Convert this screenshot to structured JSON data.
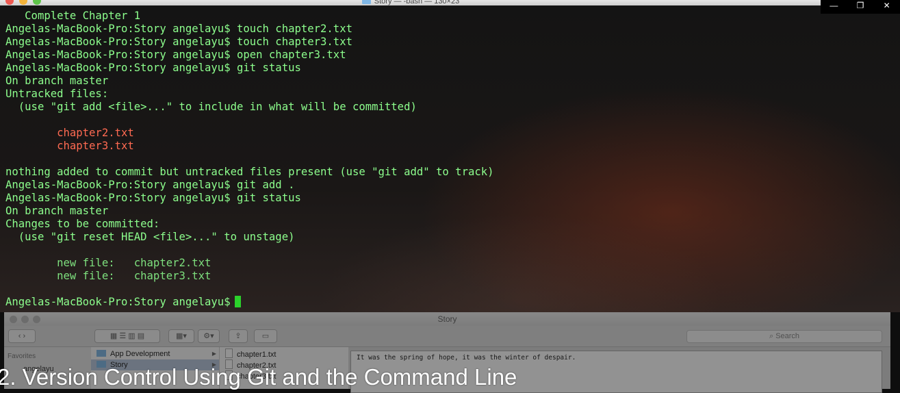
{
  "terminal": {
    "title": "Story — -bash — 130×23",
    "lines": [
      {
        "text": "   Complete Chapter 1",
        "style": "normal"
      },
      {
        "text": "Angelas-MacBook-Pro:Story angelayu$ touch chapter2.txt",
        "style": "normal"
      },
      {
        "text": "Angelas-MacBook-Pro:Story angelayu$ touch chapter3.txt",
        "style": "normal"
      },
      {
        "text": "Angelas-MacBook-Pro:Story angelayu$ open chapter3.txt",
        "style": "normal"
      },
      {
        "text": "Angelas-MacBook-Pro:Story angelayu$ git status",
        "style": "normal"
      },
      {
        "text": "On branch master",
        "style": "normal"
      },
      {
        "text": "Untracked files:",
        "style": "normal"
      },
      {
        "text": "  (use \"git add <file>...\" to include in what will be committed)",
        "style": "normal"
      },
      {
        "text": "",
        "style": "normal"
      },
      {
        "text": "        chapter2.txt",
        "style": "red"
      },
      {
        "text": "        chapter3.txt",
        "style": "red"
      },
      {
        "text": "",
        "style": "normal"
      },
      {
        "text": "nothing added to commit but untracked files present (use \"git add\" to track)",
        "style": "normal"
      },
      {
        "text": "Angelas-MacBook-Pro:Story angelayu$ git add .",
        "style": "normal"
      },
      {
        "text": "Angelas-MacBook-Pro:Story angelayu$ git status",
        "style": "normal"
      },
      {
        "text": "On branch master",
        "style": "normal"
      },
      {
        "text": "Changes to be committed:",
        "style": "normal"
      },
      {
        "text": "  (use \"git reset HEAD <file>...\" to unstage)",
        "style": "normal"
      },
      {
        "text": "",
        "style": "normal"
      },
      {
        "text": "        new file:   chapter2.txt",
        "style": "green"
      },
      {
        "text": "        new file:   chapter3.txt",
        "style": "green"
      },
      {
        "text": "",
        "style": "normal"
      }
    ],
    "prompt": "Angelas-MacBook-Pro:Story angelayu$"
  },
  "window_controls": {
    "minimize": "—",
    "restore": "❐",
    "close": "✕"
  },
  "finder": {
    "title": "Story",
    "search_placeholder": "Search",
    "sidebar_heading": "Favorites",
    "sidebar_user": "angelayu",
    "folders": [
      "App Development",
      "Story"
    ],
    "files": [
      "chapter1.txt",
      "chapter2.txt",
      "chapter3.txt"
    ],
    "preview_text": "It was the spring of hope, it was the winter of despair."
  },
  "caption": "2. Version Control Using Git and the Command Line",
  "colors": {
    "terminal_text": "#8dff8d",
    "untracked": "#ff6a52",
    "staged": "#7ee07e",
    "cursor": "#2bd12b"
  }
}
